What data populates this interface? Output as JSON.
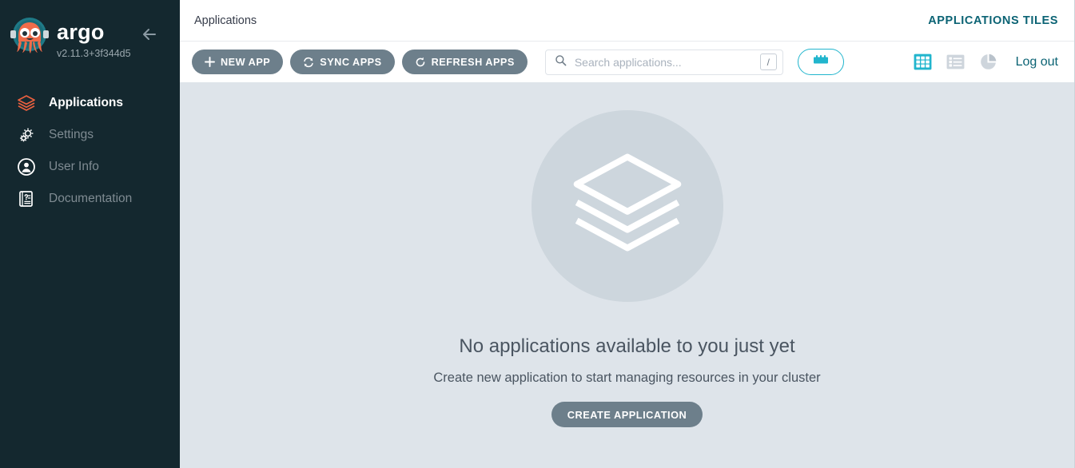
{
  "brand": {
    "name": "argo",
    "version": "v2.11.3+3f344d5",
    "logo_icon": "argo-octopus-logo",
    "collapse_icon": "arrow-left-icon"
  },
  "sidebar": {
    "items": [
      {
        "label": "Applications",
        "icon": "layers-icon",
        "active": true
      },
      {
        "label": "Settings",
        "icon": "gear-icon",
        "active": false
      },
      {
        "label": "User Info",
        "icon": "user-circle-icon",
        "active": false
      },
      {
        "label": "Documentation",
        "icon": "book-icon",
        "active": false
      }
    ]
  },
  "header": {
    "breadcrumb": "Applications",
    "tiles_link": "APPLICATIONS TILES"
  },
  "toolbar": {
    "new_app_label": "NEW APP",
    "new_app_icon": "plus-icon",
    "sync_apps_label": "SYNC APPS",
    "sync_apps_icon": "sync-icon",
    "refresh_apps_label": "REFRESH APPS",
    "refresh_apps_icon": "refresh-icon",
    "search": {
      "placeholder": "Search applications...",
      "value": "",
      "icon": "search-icon",
      "shortcut": "/"
    },
    "filter_icon": "filter-sliders-icon",
    "views": [
      {
        "icon": "grid-view-icon",
        "active": true
      },
      {
        "icon": "list-view-icon",
        "active": false
      },
      {
        "icon": "pie-chart-view-icon",
        "active": false
      }
    ],
    "logout_label": "Log out"
  },
  "empty_state": {
    "illustration_icon": "layers-stack-icon",
    "title": "No applications available to you just yet",
    "subtitle": "Create new application to start managing resources in your cluster",
    "cta_label": "CREATE APPLICATION"
  },
  "colors": {
    "sidebar_bg": "#14282f",
    "content_bg": "#dee4ea",
    "accent_teal": "#21b5cd",
    "link_teal": "#0b6374",
    "button_gray": "#6d7f8b",
    "active_orange": "#e96d4c"
  }
}
